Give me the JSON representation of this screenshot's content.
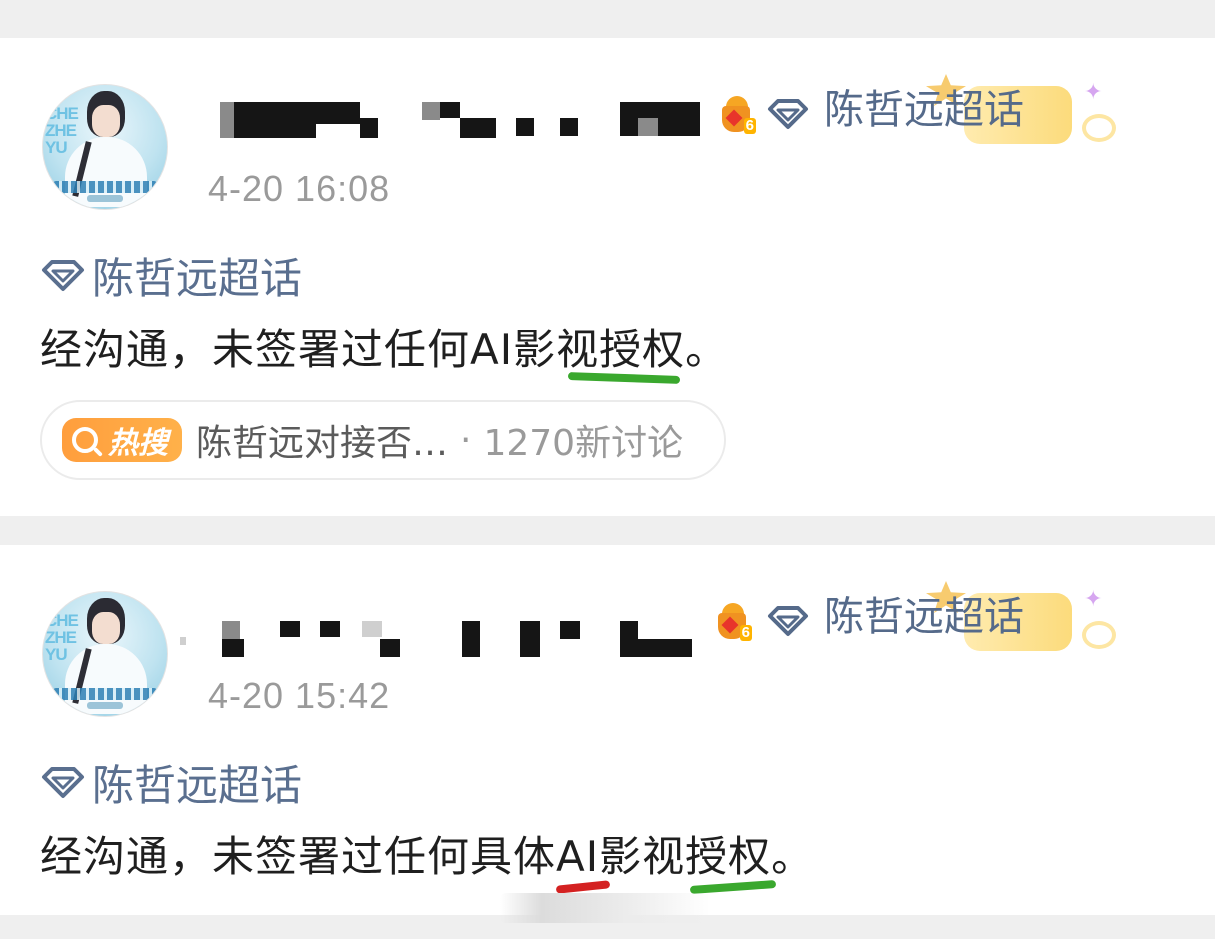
{
  "colors": {
    "background": "#efefef",
    "card": "#ffffff",
    "link": "#556a8a",
    "timestamp": "#9a9a9a",
    "hot_badge": "#ff9e3d",
    "underline_green": "#3aa82e",
    "underline_red": "#d42121"
  },
  "posts": [
    {
      "author_name_redacted": true,
      "rank_level": "6",
      "super_topic_tag": "陈哲远超话",
      "time": "4-20 16:08",
      "topic_link": "陈哲远超话",
      "text": "经沟通，未签署过任何AI影视授权。",
      "hot_search": {
        "badge": "热搜",
        "topic": "陈哲远对接否…",
        "separator": "·",
        "count": "1270新讨论"
      }
    },
    {
      "author_name_redacted": true,
      "rank_level": "6",
      "super_topic_tag": "陈哲远超话",
      "time": "4-20 15:42",
      "topic_link": "陈哲远超话",
      "text": "经沟通，未签署过任何具体AI影视授权。"
    }
  ]
}
